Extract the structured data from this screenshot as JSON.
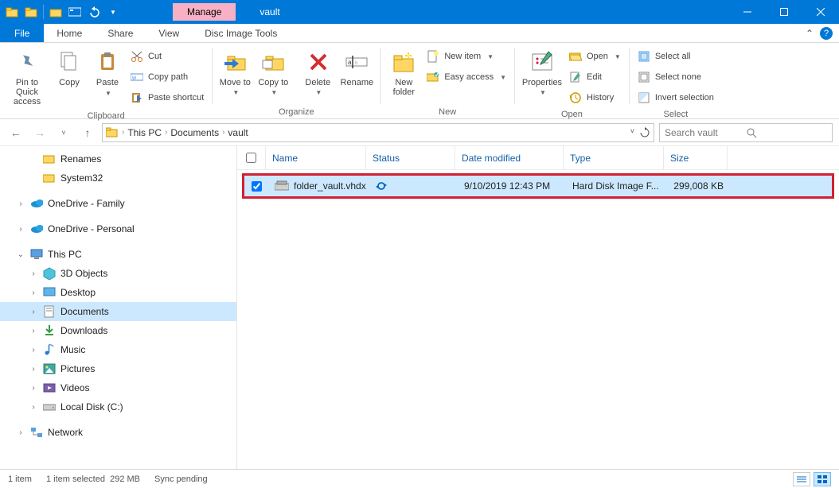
{
  "window": {
    "title": "vault",
    "context_tab": "Manage"
  },
  "tabs": {
    "file": "File",
    "home": "Home",
    "share": "Share",
    "view": "View",
    "context": "Disc Image Tools"
  },
  "ribbon": {
    "clipboard": {
      "pin": "Pin to Quick access",
      "copy": "Copy",
      "paste": "Paste",
      "cut": "Cut",
      "copy_path": "Copy path",
      "paste_shortcut": "Paste shortcut",
      "label": "Clipboard"
    },
    "organize": {
      "move_to": "Move to",
      "copy_to": "Copy to",
      "delete": "Delete",
      "rename": "Rename",
      "label": "Organize"
    },
    "new": {
      "new_folder": "New folder",
      "new_item": "New item",
      "easy_access": "Easy access",
      "label": "New"
    },
    "open": {
      "properties": "Properties",
      "open": "Open",
      "edit": "Edit",
      "history": "History",
      "label": "Open"
    },
    "select": {
      "select_all": "Select all",
      "select_none": "Select none",
      "invert": "Invert selection",
      "label": "Select"
    }
  },
  "breadcrumb": {
    "items": [
      "This PC",
      "Documents",
      "vault"
    ]
  },
  "search": {
    "placeholder": "Search vault"
  },
  "nav": {
    "renames": "Renames",
    "system32": "System32",
    "onedrive_family": "OneDrive - Family",
    "onedrive_personal": "OneDrive - Personal",
    "this_pc": "This PC",
    "objects3d": "3D Objects",
    "desktop": "Desktop",
    "documents": "Documents",
    "downloads": "Downloads",
    "music": "Music",
    "pictures": "Pictures",
    "videos": "Videos",
    "local_disk": "Local Disk (C:)",
    "network": "Network"
  },
  "columns": {
    "name": "Name",
    "status": "Status",
    "date": "Date modified",
    "type": "Type",
    "size": "Size"
  },
  "file": {
    "name": "folder_vault.vhdx",
    "date": "9/10/2019 12:43 PM",
    "type": "Hard Disk Image F...",
    "size": "299,008 KB"
  },
  "status": {
    "count": "1 item",
    "selected": "1 item selected",
    "sel_size": "292 MB",
    "sync": "Sync pending"
  }
}
